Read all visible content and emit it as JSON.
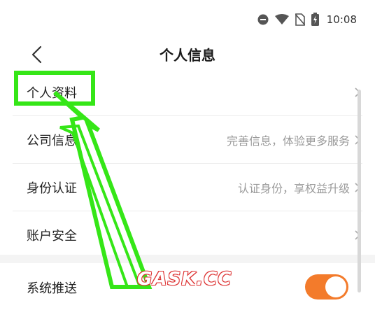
{
  "status_bar": {
    "time": "10:08",
    "icons": [
      "dnd-icon",
      "wifi-icon",
      "no-sim-icon",
      "battery-charging-icon"
    ]
  },
  "nav": {
    "title": "个人信息",
    "back_icon": "chevron-left-icon"
  },
  "list": {
    "items": [
      {
        "label": "个人资料",
        "value": ""
      },
      {
        "label": "公司信息",
        "value": "完善信息，体验更多服务"
      },
      {
        "label": "身份认证",
        "value": "认证身份，享权益升级"
      },
      {
        "label": "账户安全",
        "value": ""
      }
    ]
  },
  "settings": {
    "push_label": "系统推送",
    "push_enabled": true
  },
  "colors": {
    "accent": "#f37b2b",
    "annotation": "#35e617"
  },
  "watermark": "GASK.CC"
}
